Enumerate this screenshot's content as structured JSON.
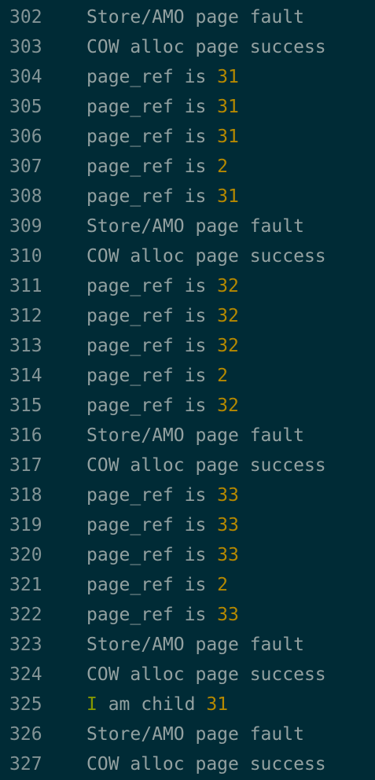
{
  "colors": {
    "background": "#002b36",
    "text": "#93a1a1",
    "line_number": "#839496",
    "number": "#b58900",
    "keyword": "#859900"
  },
  "lines": [
    {
      "no": "302",
      "parts": [
        {
          "t": "Store/AMO page fault",
          "k": "text"
        }
      ]
    },
    {
      "no": "303",
      "parts": [
        {
          "t": "COW alloc page success",
          "k": "text"
        }
      ]
    },
    {
      "no": "304",
      "parts": [
        {
          "t": "page_ref is ",
          "k": "text"
        },
        {
          "t": "31",
          "k": "num"
        }
      ]
    },
    {
      "no": "305",
      "parts": [
        {
          "t": "page_ref is ",
          "k": "text"
        },
        {
          "t": "31",
          "k": "num"
        }
      ]
    },
    {
      "no": "306",
      "parts": [
        {
          "t": "page_ref is ",
          "k": "text"
        },
        {
          "t": "31",
          "k": "num"
        }
      ]
    },
    {
      "no": "307",
      "parts": [
        {
          "t": "page_ref is ",
          "k": "text"
        },
        {
          "t": "2",
          "k": "num"
        }
      ]
    },
    {
      "no": "308",
      "parts": [
        {
          "t": "page_ref is ",
          "k": "text"
        },
        {
          "t": "31",
          "k": "num"
        }
      ]
    },
    {
      "no": "309",
      "parts": [
        {
          "t": "Store/AMO page fault",
          "k": "text"
        }
      ]
    },
    {
      "no": "310",
      "parts": [
        {
          "t": "COW alloc page success",
          "k": "text"
        }
      ]
    },
    {
      "no": "311",
      "parts": [
        {
          "t": "page_ref is ",
          "k": "text"
        },
        {
          "t": "32",
          "k": "num"
        }
      ]
    },
    {
      "no": "312",
      "parts": [
        {
          "t": "page_ref is ",
          "k": "text"
        },
        {
          "t": "32",
          "k": "num"
        }
      ]
    },
    {
      "no": "313",
      "parts": [
        {
          "t": "page_ref is ",
          "k": "text"
        },
        {
          "t": "32",
          "k": "num"
        }
      ]
    },
    {
      "no": "314",
      "parts": [
        {
          "t": "page_ref is ",
          "k": "text"
        },
        {
          "t": "2",
          "k": "num"
        }
      ]
    },
    {
      "no": "315",
      "parts": [
        {
          "t": "page_ref is ",
          "k": "text"
        },
        {
          "t": "32",
          "k": "num"
        }
      ]
    },
    {
      "no": "316",
      "parts": [
        {
          "t": "Store/AMO page fault",
          "k": "text"
        }
      ]
    },
    {
      "no": "317",
      "parts": [
        {
          "t": "COW alloc page success",
          "k": "text"
        }
      ]
    },
    {
      "no": "318",
      "parts": [
        {
          "t": "page_ref is ",
          "k": "text"
        },
        {
          "t": "33",
          "k": "num"
        }
      ]
    },
    {
      "no": "319",
      "parts": [
        {
          "t": "page_ref is ",
          "k": "text"
        },
        {
          "t": "33",
          "k": "num"
        }
      ]
    },
    {
      "no": "320",
      "parts": [
        {
          "t": "page_ref is ",
          "k": "text"
        },
        {
          "t": "33",
          "k": "num"
        }
      ]
    },
    {
      "no": "321",
      "parts": [
        {
          "t": "page_ref is ",
          "k": "text"
        },
        {
          "t": "2",
          "k": "num"
        }
      ]
    },
    {
      "no": "322",
      "parts": [
        {
          "t": "page_ref is ",
          "k": "text"
        },
        {
          "t": "33",
          "k": "num"
        }
      ]
    },
    {
      "no": "323",
      "parts": [
        {
          "t": "Store/AMO page fault",
          "k": "text"
        }
      ]
    },
    {
      "no": "324",
      "parts": [
        {
          "t": "COW alloc page success",
          "k": "text"
        }
      ]
    },
    {
      "no": "325",
      "parts": [
        {
          "t": "I",
          "k": "kw"
        },
        {
          "t": " am child ",
          "k": "text"
        },
        {
          "t": "31",
          "k": "num"
        }
      ]
    },
    {
      "no": "326",
      "parts": [
        {
          "t": "Store/AMO page fault",
          "k": "text"
        }
      ]
    },
    {
      "no": "327",
      "parts": [
        {
          "t": "COW alloc page success",
          "k": "text"
        }
      ]
    }
  ]
}
